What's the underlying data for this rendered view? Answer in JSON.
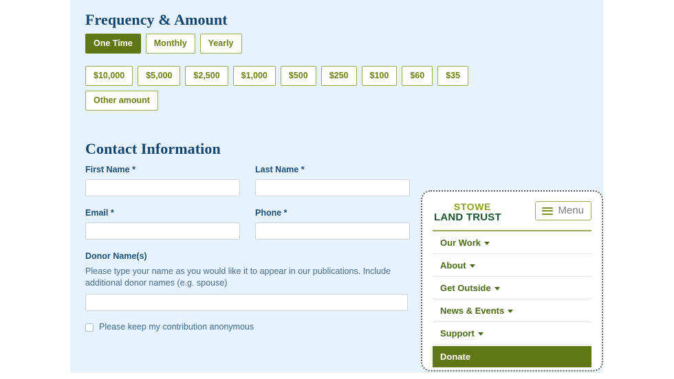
{
  "donation_form": {
    "frequency_section": {
      "heading": "Frequency & Amount",
      "frequencies": [
        {
          "label": "One Time",
          "active": true
        },
        {
          "label": "Monthly",
          "active": false
        },
        {
          "label": "Yearly",
          "active": false
        }
      ],
      "amounts": [
        "$10,000",
        "$5,000",
        "$2,500",
        "$1,000",
        "$500",
        "$250",
        "$100",
        "$60",
        "$35"
      ],
      "other_amount_label": "Other amount"
    },
    "contact_section": {
      "heading": "Contact Information",
      "fields": [
        {
          "label": "First Name *",
          "value": "",
          "placeholder": ""
        },
        {
          "label": "Last Name *",
          "value": "",
          "placeholder": ""
        },
        {
          "label": "Email *",
          "value": "",
          "placeholder": ""
        },
        {
          "label": "Phone *",
          "value": "",
          "placeholder": ""
        }
      ],
      "donor_names": {
        "label": "Donor Name(s)",
        "help_text": "Please type your name as you would like it to appear in our publications. Include additional donor names (e.g. spouse)",
        "value": "",
        "placeholder": ""
      },
      "anonymous": {
        "label": "Please keep my contribution anonymous",
        "checked": false
      }
    }
  },
  "nav_card": {
    "logo": {
      "line_1": "STOWE",
      "line_2": "LAND TRUST",
      "color_1": "#8aa318",
      "color_2": "#17562e"
    },
    "menu_button": {
      "label": "Menu",
      "icon": "hamburger-icon"
    },
    "items": [
      {
        "label": "Our Work",
        "has_caret": true
      },
      {
        "label": "About",
        "has_caret": true
      },
      {
        "label": "Get Outside",
        "has_caret": true
      },
      {
        "label": "News & Events",
        "has_caret": true
      },
      {
        "label": "Support",
        "has_caret": true
      }
    ],
    "donate": {
      "label": "Donate"
    }
  },
  "colors": {
    "panel_background": "#e6f2fc",
    "heading": "#14456e",
    "accent_olive": "#5f7715",
    "accent_olive_light": "#9aad55",
    "nav_text": "#4c6b18"
  }
}
